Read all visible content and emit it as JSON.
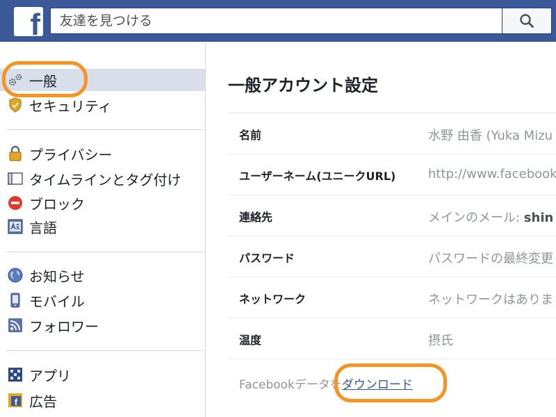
{
  "header": {
    "search_placeholder": "友達を見つける",
    "logo_letter": "f",
    "brand_color": "#3b5998"
  },
  "sidebar": {
    "groups": [
      [
        {
          "label": "一般",
          "icon": "gears-icon",
          "active": true
        },
        {
          "label": "セキュリティ",
          "icon": "shield-badge-icon"
        }
      ],
      [
        {
          "label": "プライバシー",
          "icon": "padlock-icon"
        },
        {
          "label": "タイムラインとタグ付け",
          "icon": "timeline-icon"
        },
        {
          "label": "ブロック",
          "icon": "block-icon"
        },
        {
          "label": "言語",
          "icon": "language-icon"
        }
      ],
      [
        {
          "label": "お知らせ",
          "icon": "globe-icon"
        },
        {
          "label": "モバイル",
          "icon": "mobile-icon"
        },
        {
          "label": "フォロワー",
          "icon": "rss-icon"
        }
      ],
      [
        {
          "label": "アプリ",
          "icon": "apps-icon"
        },
        {
          "label": "広告",
          "icon": "ads-icon"
        }
      ]
    ]
  },
  "main": {
    "title": "一般アカウント設定",
    "rows": [
      {
        "label": "名前",
        "value": "水野 由香 (Yuka Mizu"
      },
      {
        "label": "ユーザーネーム(ユニークURL)",
        "value": "http://www.facebook.c"
      },
      {
        "label": "連絡先",
        "value_prefix": "メインのメール: ",
        "value_bold": "shin"
      },
      {
        "label": "パスワード",
        "value": "パスワードの最終変更"
      },
      {
        "label": "ネットワーク",
        "value": "ネットワークはありま"
      },
      {
        "label": "温度",
        "value": "摂氏"
      }
    ],
    "download": {
      "prefix": "Facebookデータを",
      "link": "ダウンロード"
    }
  },
  "highlight_color": "#f7931e"
}
